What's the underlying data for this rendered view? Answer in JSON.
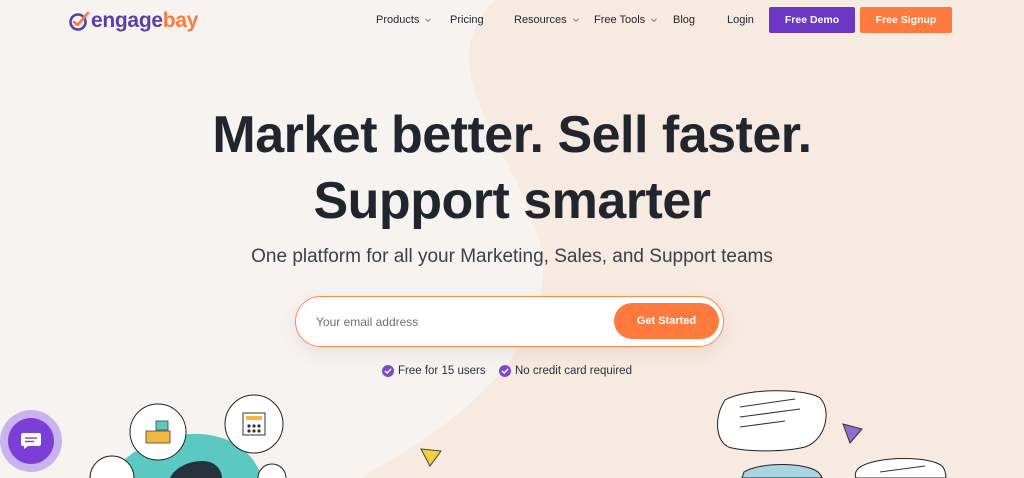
{
  "brand": {
    "name_part1": "engage",
    "name_part2": "bay",
    "colors": {
      "purple": "#6c37c5",
      "orange": "#ff7a3d"
    }
  },
  "nav": {
    "items": [
      {
        "label": "Products",
        "has_dropdown": true
      },
      {
        "label": "Pricing",
        "has_dropdown": false
      },
      {
        "label": "Resources",
        "has_dropdown": true
      },
      {
        "label": "Free Tools",
        "has_dropdown": true
      },
      {
        "label": "Blog",
        "has_dropdown": false
      },
      {
        "label": "Login",
        "has_dropdown": false
      }
    ],
    "demo_button": "Free Demo",
    "signup_button": "Free Signup"
  },
  "hero": {
    "headline_line1": "Market better. Sell faster.",
    "headline_line2": "Support smarter",
    "subtitle": "One platform for all your Marketing, Sales, and Support teams",
    "email_placeholder": "Your email address",
    "cta_button": "Get Started",
    "perks": [
      "Free for 15 users",
      "No credit card required"
    ]
  },
  "icons": {
    "logo": "engagebay-logo-icon",
    "dropdown": "chevron-down-icon",
    "check": "check-circle-icon",
    "chat": "chat-icon"
  }
}
